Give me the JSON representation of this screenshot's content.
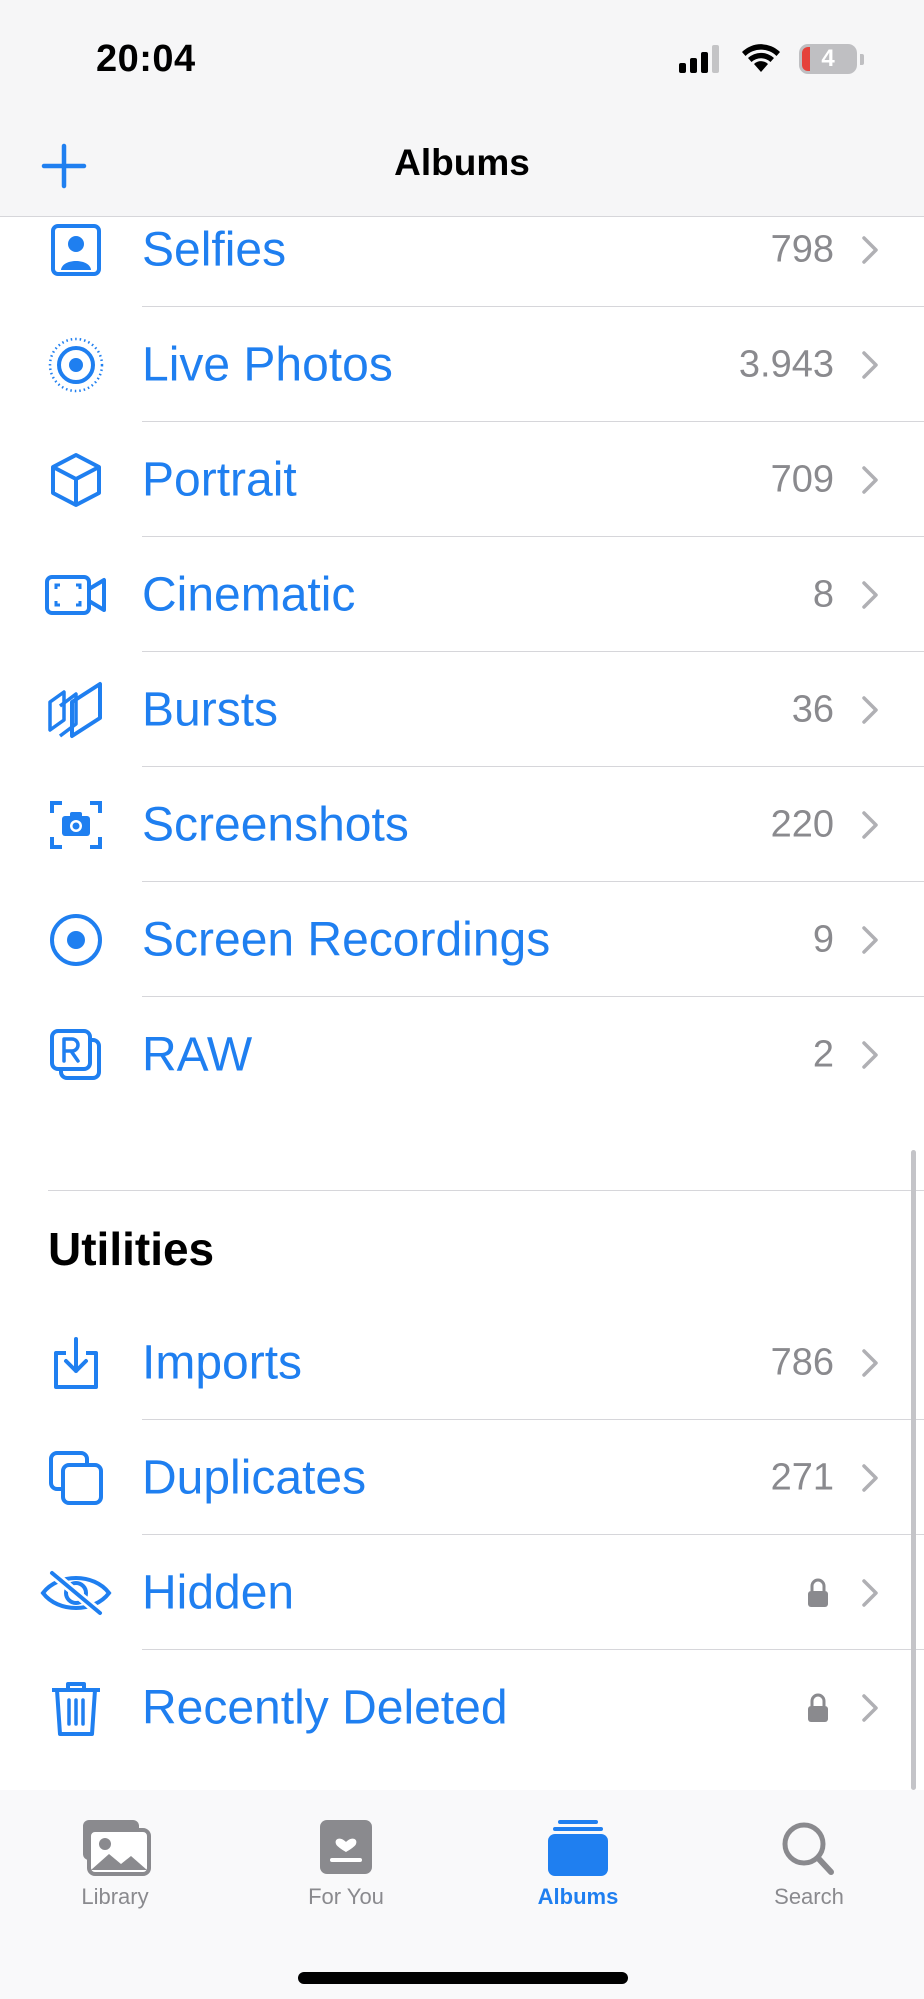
{
  "status_bar": {
    "time": "20:04",
    "battery_level": "4"
  },
  "nav": {
    "title": "Albums"
  },
  "media_types": [
    {
      "label": "Selfies",
      "count": "798",
      "icon": "selfie-icon"
    },
    {
      "label": "Live Photos",
      "count": "3.943",
      "icon": "live-photo-icon"
    },
    {
      "label": "Portrait",
      "count": "709",
      "icon": "cube-icon"
    },
    {
      "label": "Cinematic",
      "count": "8",
      "icon": "cinematic-icon"
    },
    {
      "label": "Bursts",
      "count": "36",
      "icon": "bursts-icon"
    },
    {
      "label": "Screenshots",
      "count": "220",
      "icon": "screenshot-icon"
    },
    {
      "label": "Screen Recordings",
      "count": "9",
      "icon": "record-icon"
    },
    {
      "label": "RAW",
      "count": "2",
      "icon": "raw-icon"
    }
  ],
  "utilities": {
    "title": "Utilities",
    "items": [
      {
        "label": "Imports",
        "count": "786",
        "icon": "import-icon"
      },
      {
        "label": "Duplicates",
        "count": "271",
        "icon": "duplicates-icon"
      },
      {
        "label": "Hidden",
        "count": "",
        "icon": "eye-slash-icon",
        "locked": true
      },
      {
        "label": "Recently Deleted",
        "count": "",
        "icon": "trash-icon",
        "locked": true
      }
    ]
  },
  "tabs": [
    {
      "label": "Library",
      "icon": "photos-icon",
      "active": false
    },
    {
      "label": "For You",
      "icon": "for-you-icon",
      "active": false
    },
    {
      "label": "Albums",
      "icon": "albums-icon",
      "active": true
    },
    {
      "label": "Search",
      "icon": "search-icon",
      "active": false
    }
  ],
  "colors": {
    "accent": "#1f7ff0",
    "secondary_text": "#8a8a8e",
    "separator": "#d6d6da"
  }
}
